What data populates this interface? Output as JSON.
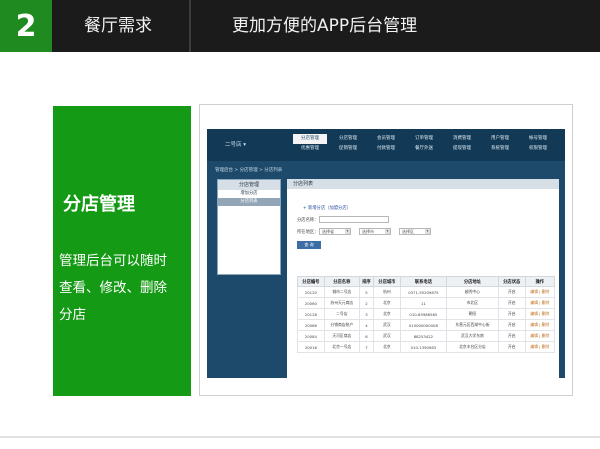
{
  "header": {
    "number": "2",
    "section": "餐厅需求",
    "title": "更加方便的APP后台管理"
  },
  "panel": {
    "title": "分店管理",
    "lines": [
      "管理后台可以随时",
      "查看、修改、删除",
      "分店"
    ]
  },
  "app": {
    "logo": "二号店",
    "nav_row1": [
      "分店管理",
      "分店管理",
      "会员管理",
      "订单管理",
      "消费管理",
      "用户管理",
      "帐号管理"
    ],
    "nav_row2": [
      "优惠管理",
      "促销管理",
      "付款管理",
      "餐厅外送",
      "提现管理",
      "系统管理",
      "权限管理"
    ],
    "breadcrumb": "管理后台 > 分店管理 > 分店列表",
    "sidebar": {
      "header": "分店管理",
      "items": [
        "增加分店",
        "分店列表"
      ]
    },
    "main": {
      "header": "分店列表",
      "add_link": "新增分店（加盟分店）",
      "name_label": "分店名称：",
      "filter_label": "所在地区：",
      "selects": [
        "选择省",
        "选择市",
        "选择区"
      ],
      "query_button": "查 询",
      "table": {
        "columns": [
          "分店编号",
          "分店名称",
          "排序",
          "分店城市",
          "联系电话",
          "分店地址",
          "分店状态",
          "操作"
        ],
        "rows": [
          [
            "20120",
            "城市二号店",
            "5",
            "杭州",
            "0371-55209875",
            "越秀中心",
            "开启",
            "编辑 | 删除"
          ],
          [
            "20060",
            "苏州天元商店",
            "2",
            "北京",
            "11",
            "市北区",
            "开启",
            "编辑 | 删除"
          ],
          [
            "20128",
            "二号店",
            "3",
            "北京",
            "010-85986565",
            "朝阳",
            "开启",
            "编辑 | 删除"
          ],
          [
            "20086",
            "分销商店帐户",
            "4",
            "武汉",
            "010000000008",
            "东营元区西湖中心街",
            "开启",
            "编辑 | 删除"
          ],
          [
            "20084",
            "天河区商店",
            "6",
            "武汉",
            "88253422",
            "武汉大学东南",
            "开启",
            "编辑 | 删除"
          ],
          [
            "20016",
            "北京一号店",
            "7",
            "北京",
            "010-1390983",
            "北京丰台区分店",
            "开启",
            "编辑 | 删除"
          ]
        ]
      }
    }
  }
}
